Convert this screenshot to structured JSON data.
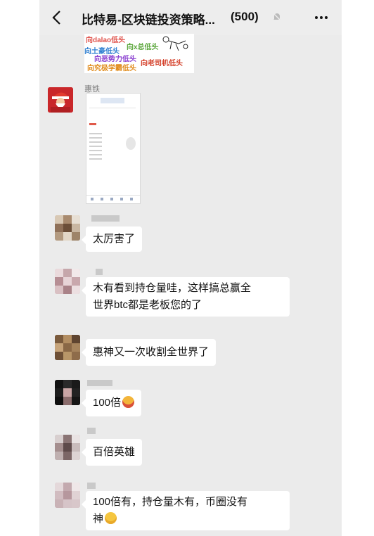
{
  "header": {
    "title": "比特易-区块链投资策略...",
    "member_count": "(500)"
  },
  "sticker": {
    "lines": [
      "向dalao低头",
      "向x总低头",
      "向土豪低头",
      "向恶势力低头",
      "向老司机低头",
      "向究极学霸低头"
    ],
    "colors": [
      "#e0524b",
      "#5aa63a",
      "#2f7fd1",
      "#8a3fd0",
      "#d4402a",
      "#e08a1a"
    ]
  },
  "messages": [
    {
      "sender": "惠铁",
      "type": "image"
    },
    {
      "sender": "",
      "type": "text",
      "text": "太厉害了"
    },
    {
      "sender": "",
      "type": "text",
      "lines": [
        "木有看到持仓量哇，这样搞总赢全",
        "世界btc都是老板您的了"
      ]
    },
    {
      "sender": "",
      "type": "text",
      "text": "惠神又一次收割全世界了"
    },
    {
      "sender": "",
      "type": "text",
      "text": "100倍",
      "emoji": "grin-emoji"
    },
    {
      "sender": "",
      "type": "text",
      "text": "百倍英雄"
    },
    {
      "sender": "",
      "type": "text",
      "lines": [
        "100倍有，持仓量木有，币圈没有",
        "神"
      ],
      "emoji": "smile-emoji"
    }
  ]
}
